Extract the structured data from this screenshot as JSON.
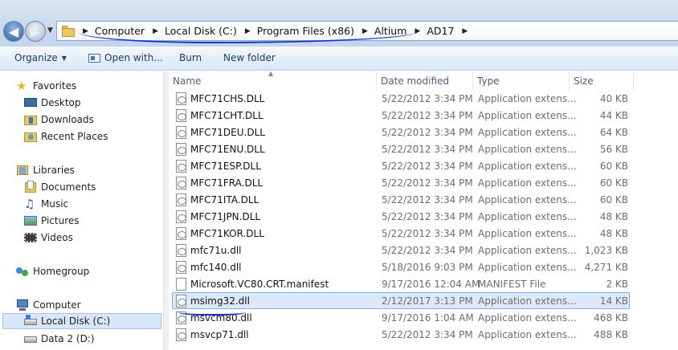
{
  "breadcrumb": [
    "Computer",
    "Local Disk (C:)",
    "Program Files (x86)",
    "Altium",
    "AD17"
  ],
  "toolbar": {
    "organize": "Organize",
    "open_with": "Open with...",
    "burn": "Burn",
    "new_folder": "New folder"
  },
  "nav": {
    "favorites": "Favorites",
    "desktop": "Desktop",
    "downloads": "Downloads",
    "recent_places": "Recent Places",
    "libraries": "Libraries",
    "documents": "Documents",
    "music": "Music",
    "pictures": "Pictures",
    "videos": "Videos",
    "homegroup": "Homegroup",
    "computer": "Computer",
    "local_disk": "Local Disk (C:)",
    "data2": "Data 2 (D:)"
  },
  "columns": {
    "name": "Name",
    "date_modified": "Date modified",
    "type": "Type",
    "size": "Size"
  },
  "files": [
    {
      "name": "MFC71CHS.DLL",
      "date": "5/22/2012 3:34 PM",
      "type": "Application extens...",
      "size": "40 KB",
      "kind": "dll"
    },
    {
      "name": "MFC71CHT.DLL",
      "date": "5/22/2012 3:34 PM",
      "type": "Application extens...",
      "size": "44 KB",
      "kind": "dll"
    },
    {
      "name": "MFC71DEU.DLL",
      "date": "5/22/2012 3:34 PM",
      "type": "Application extens...",
      "size": "64 KB",
      "kind": "dll"
    },
    {
      "name": "MFC71ENU.DLL",
      "date": "5/22/2012 3:34 PM",
      "type": "Application extens...",
      "size": "56 KB",
      "kind": "dll"
    },
    {
      "name": "MFC71ESP.DLL",
      "date": "5/22/2012 3:34 PM",
      "type": "Application extens...",
      "size": "60 KB",
      "kind": "dll"
    },
    {
      "name": "MFC71FRA.DLL",
      "date": "5/22/2012 3:34 PM",
      "type": "Application extens...",
      "size": "60 KB",
      "kind": "dll"
    },
    {
      "name": "MFC71ITA.DLL",
      "date": "5/22/2012 3:34 PM",
      "type": "Application extens...",
      "size": "60 KB",
      "kind": "dll"
    },
    {
      "name": "MFC71JPN.DLL",
      "date": "5/22/2012 3:34 PM",
      "type": "Application extens...",
      "size": "48 KB",
      "kind": "dll"
    },
    {
      "name": "MFC71KOR.DLL",
      "date": "5/22/2012 3:34 PM",
      "type": "Application extens...",
      "size": "48 KB",
      "kind": "dll"
    },
    {
      "name": "mfc71u.dll",
      "date": "5/22/2012 3:34 PM",
      "type": "Application extens...",
      "size": "1,023 KB",
      "kind": "dll"
    },
    {
      "name": "mfc140.dll",
      "date": "5/18/2016 9:03 PM",
      "type": "Application extens...",
      "size": "4,271 KB",
      "kind": "dll"
    },
    {
      "name": "Microsoft.VC80.CRT.manifest",
      "date": "9/17/2016 12:04 AM",
      "type": "MANIFEST File",
      "size": "2 KB",
      "kind": "manifest"
    },
    {
      "name": "msimg32.dll",
      "date": "2/12/2017 3:13 PM",
      "type": "Application extens...",
      "size": "14 KB",
      "kind": "dll",
      "selected": true
    },
    {
      "name": "msvcm80.dll",
      "date": "9/17/2016 1:04 AM",
      "type": "Application extens...",
      "size": "468 KB",
      "kind": "dll"
    },
    {
      "name": "msvcp71.dll",
      "date": "5/22/2012 3:34 PM",
      "type": "Application extens...",
      "size": "488 KB",
      "kind": "dll"
    }
  ],
  "colors": {
    "selection_bg": "#dde9f8",
    "selection_border": "#84acdd",
    "annotation_ink": "#1e2fcf"
  }
}
